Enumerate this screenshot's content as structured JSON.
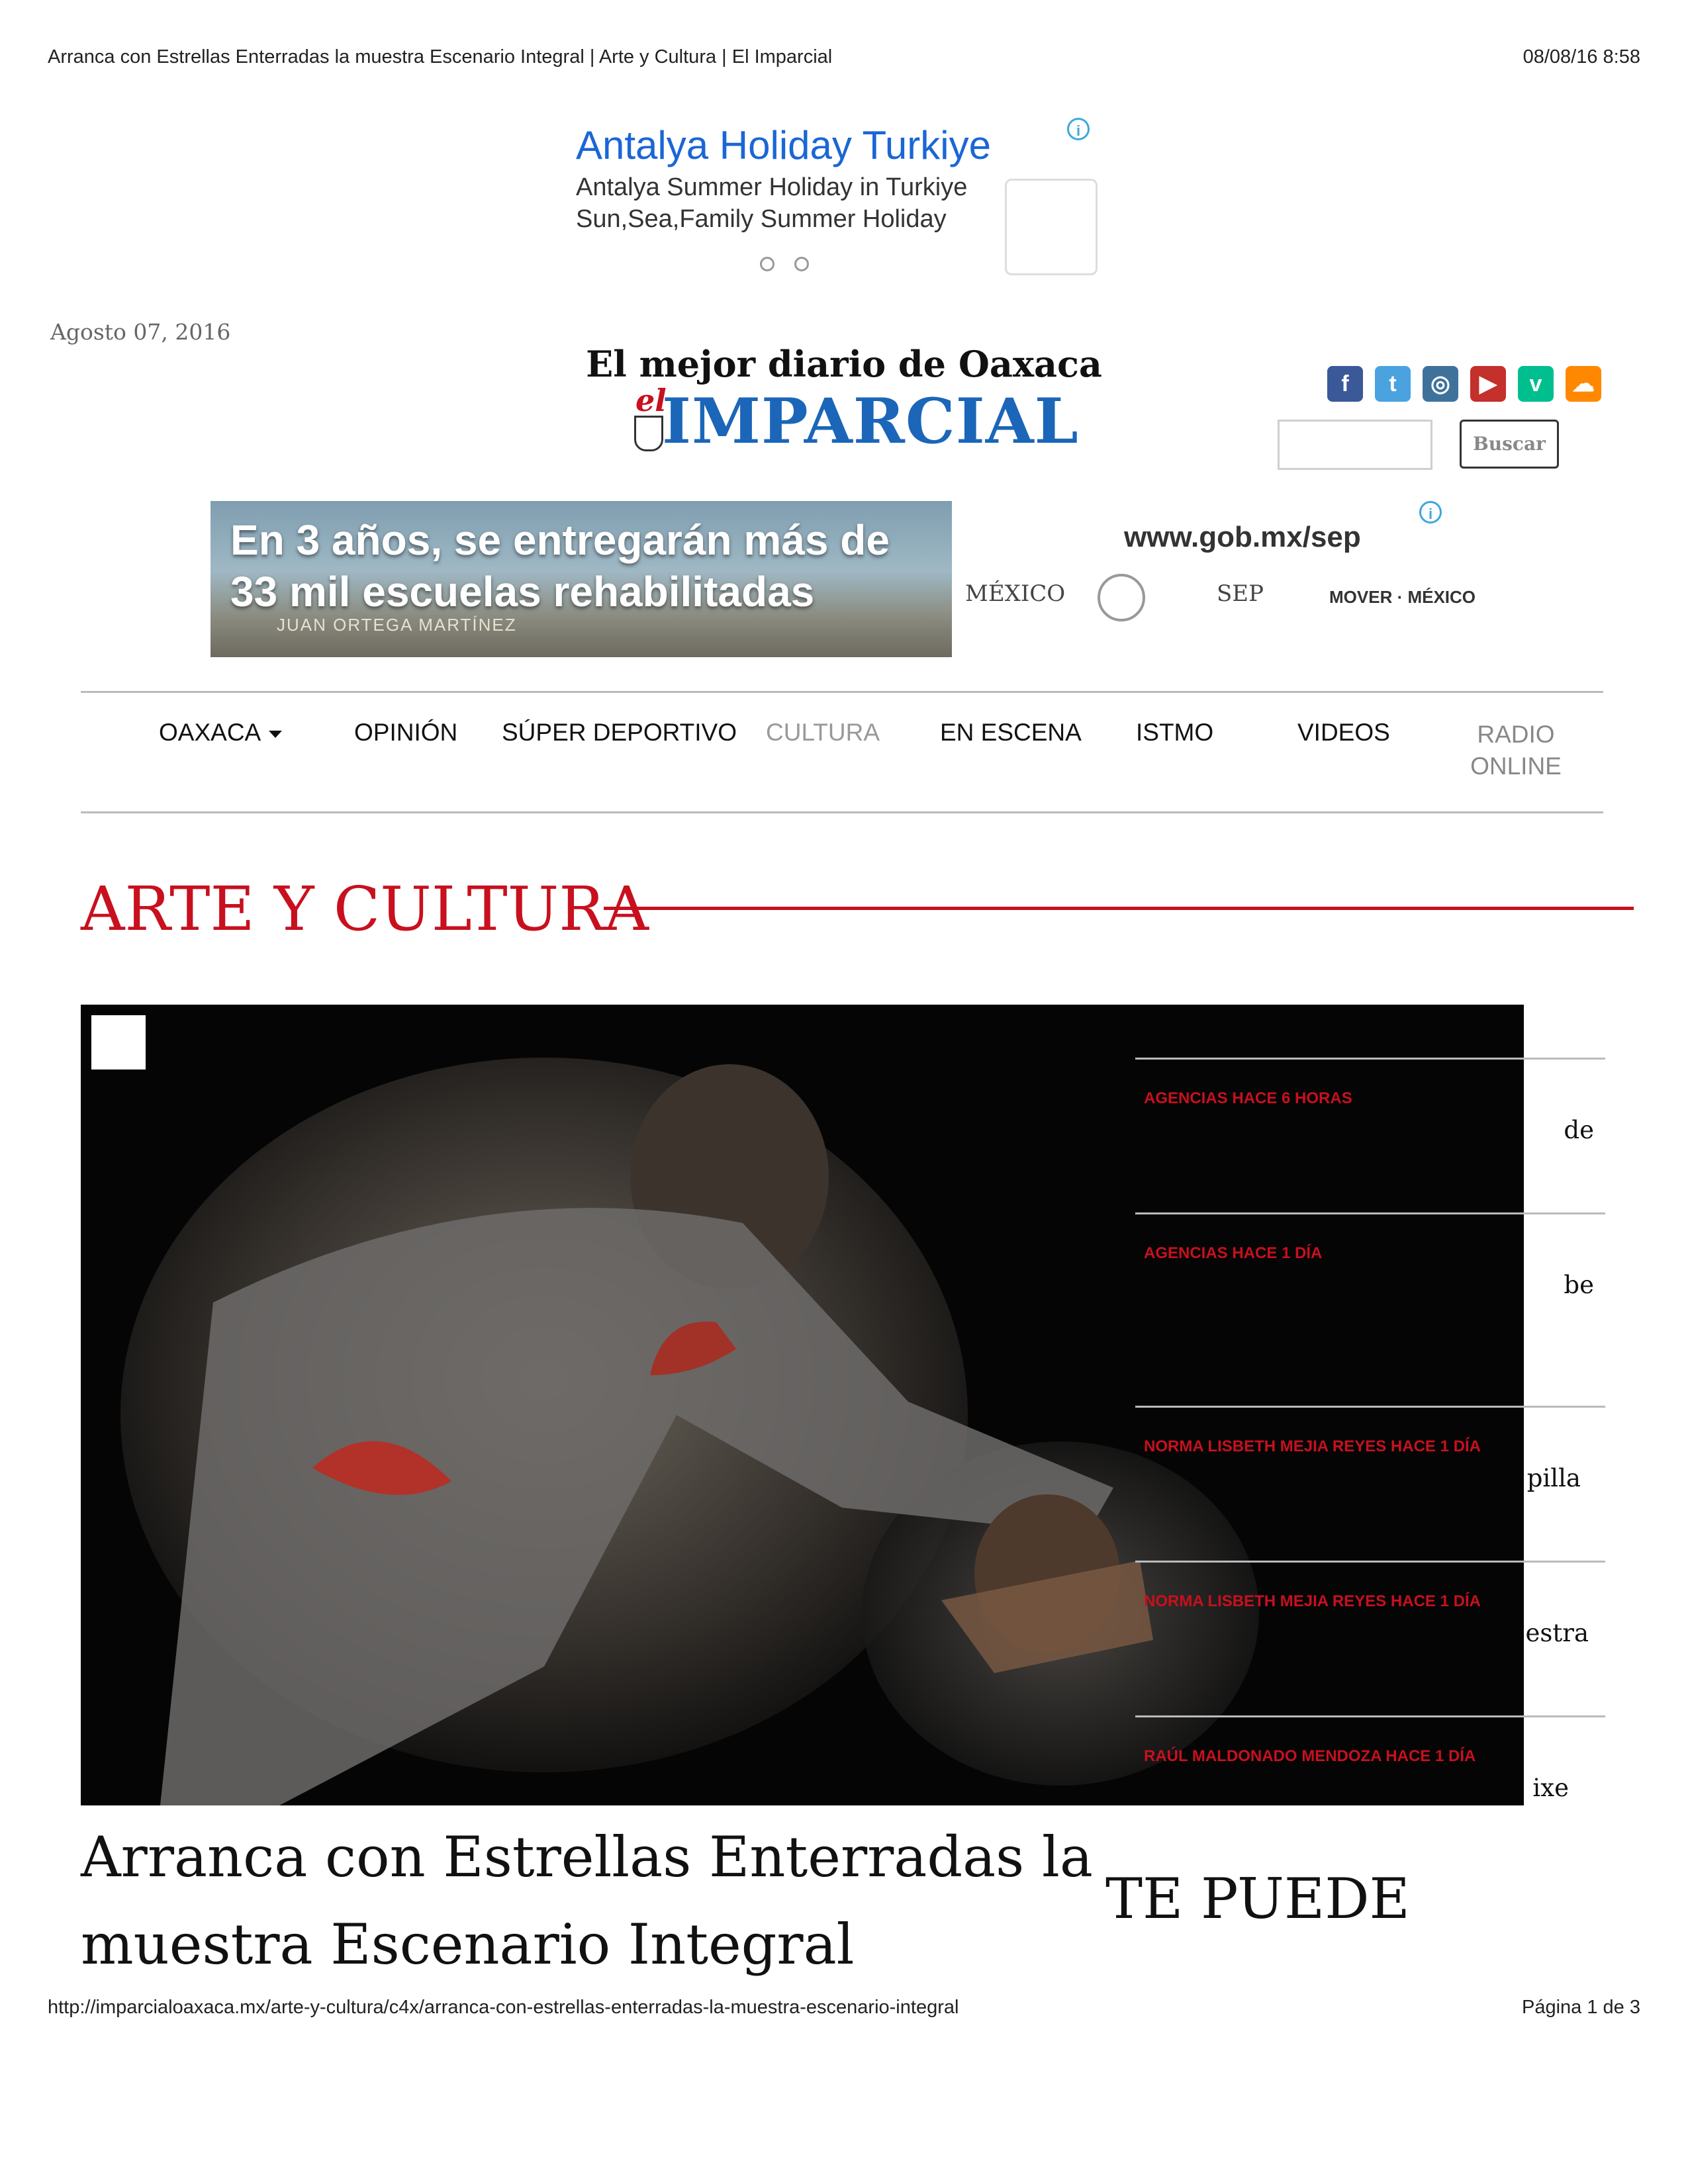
{
  "print": {
    "header_title": "Arranca con Estrellas Enterradas la muestra Escenario Integral | Arte y Cultura | El Imparcial",
    "header_datetime": "08/08/16 8:58",
    "url": "http://imparcialoaxaca.mx/arte-y-cultura/c4x/arranca-con-estrellas-enterradas-la-muestra-escenario-integral",
    "page_indicator": "Página 1 de 3"
  },
  "top_ad": {
    "title": "Antalya Holiday Turkiye",
    "line1": "Antalya Summer Holiday in Turkiye",
    "line2": "Sun,Sea,Family Summer Holiday",
    "info_icon": "i"
  },
  "site": {
    "date": "Agosto 07, 2016",
    "slogan": "El mejor diario de Oaxaca",
    "logo_prefix": "el",
    "logo_name": "IMPARCIAL",
    "brand_blue": "#1b66b8",
    "brand_red": "#c8101e"
  },
  "social": [
    {
      "icon": "facebook-icon",
      "glyph": "f",
      "color": "#3b5998"
    },
    {
      "icon": "twitter-icon",
      "glyph": "t",
      "color": "#4aa3df"
    },
    {
      "icon": "instagram-icon",
      "glyph": "◎",
      "color": "#3f729b"
    },
    {
      "icon": "youtube-icon",
      "glyph": "▶",
      "color": "#c4302b"
    },
    {
      "icon": "vine-icon",
      "glyph": "v",
      "color": "#00bf8f"
    },
    {
      "icon": "soundcloud-icon",
      "glyph": "☁",
      "color": "#ff8800"
    }
  ],
  "search": {
    "button_label": "Buscar",
    "placeholder": ""
  },
  "banner_ad": {
    "headline1": "En 3 años, se entregarán más de",
    "headline2": "33 mil escuelas rehabilitadas",
    "sign_text": "JUAN ORTEGA MARTÍNEZ",
    "url": "www.gob.mx/sep",
    "logo1": "MÉXICO",
    "logo2": "SEP",
    "logo3": "MOVER · MÉXICO"
  },
  "nav": {
    "items": [
      {
        "label": "OAXACA"
      },
      {
        "label": "OPINIÓN"
      },
      {
        "label": "SÚPER DEPORTIVO"
      },
      {
        "label": "CULTURA"
      },
      {
        "label": "EN ESCENA"
      },
      {
        "label": "ISTMO"
      },
      {
        "label": "VIDEOS"
      },
      {
        "label": "RADIO ONLINE"
      }
    ]
  },
  "section": {
    "title": "ARTE Y CULTURA"
  },
  "sidebar": {
    "items": [
      {
        "meta": "AGENCIAS HACE 6 HORAS",
        "title_visible": "de"
      },
      {
        "meta": "AGENCIAS HACE 1 DÍA",
        "title_visible": "be"
      },
      {
        "meta": "NORMA LISBETH MEJIA REYES HACE 1 DÍA",
        "title_visible": "pilla"
      },
      {
        "meta": "NORMA LISBETH MEJIA REYES HACE 1 DÍA",
        "title_visible": "estra"
      },
      {
        "meta": "RAÚL MALDONADO MENDOZA HACE 1 DÍA",
        "title_visible": "ixe"
      }
    ]
  },
  "article": {
    "title": "Arranca con Estrellas Enterradas la muestra Escenario Integral"
  },
  "related": {
    "heading": "TE PUEDE"
  }
}
